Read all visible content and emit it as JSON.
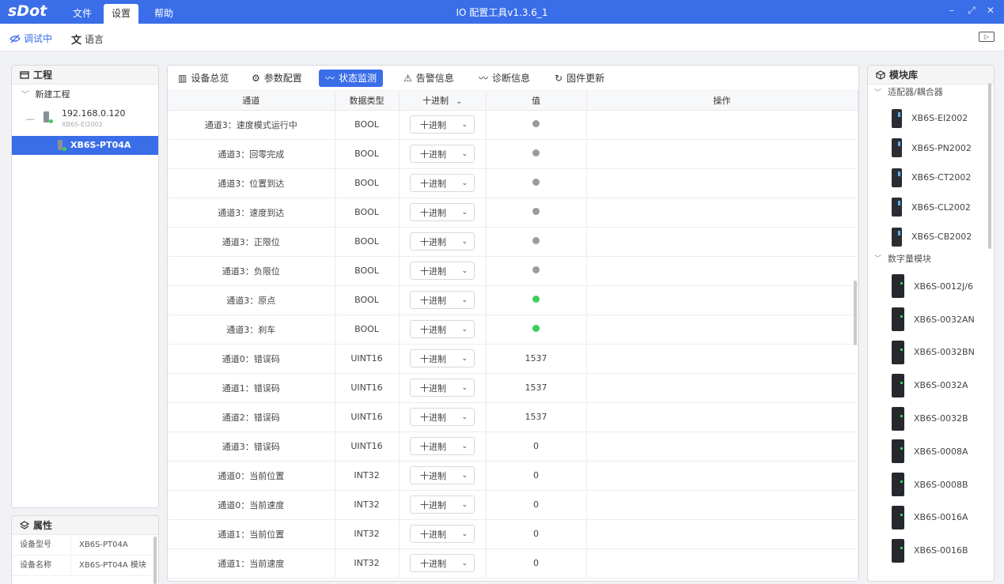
{
  "app": {
    "logo": "sDot",
    "title": "IO 配置工具v1.3.6_1",
    "menu": [
      "文件",
      "设置",
      "帮助"
    ]
  },
  "toolbar": {
    "debug_label": "调试中",
    "language_label": "语言"
  },
  "project": {
    "title": "工程",
    "root": "新建工程",
    "device_ip": "192.168.0.120",
    "device_model": "XB6S-EI2002",
    "module": "XB6S-PT04A"
  },
  "properties": {
    "title": "属性",
    "rows": [
      {
        "key": "设备型号",
        "value": "XB6S-PT04A"
      },
      {
        "key": "设备名称",
        "value": "XB6S-PT04A 模块"
      }
    ]
  },
  "tabs": [
    "设备总览",
    "参数配置",
    "状态监测",
    "告警信息",
    "诊断信息",
    "固件更新"
  ],
  "active_tab": 2,
  "table": {
    "headers": {
      "channel": "通道",
      "type": "数据类型",
      "format": "十进制",
      "value": "值",
      "action": "操作"
    },
    "format_value": "十进制",
    "rows": [
      {
        "channel": "通道3：速度模式运行中",
        "type": "BOOL",
        "value": "",
        "status": "off"
      },
      {
        "channel": "通道3：回零完成",
        "type": "BOOL",
        "value": "",
        "status": "off"
      },
      {
        "channel": "通道3：位置到达",
        "type": "BOOL",
        "value": "",
        "status": "off"
      },
      {
        "channel": "通道3：速度到达",
        "type": "BOOL",
        "value": "",
        "status": "off"
      },
      {
        "channel": "通道3：正限位",
        "type": "BOOL",
        "value": "",
        "status": "off"
      },
      {
        "channel": "通道3：负限位",
        "type": "BOOL",
        "value": "",
        "status": "off"
      },
      {
        "channel": "通道3：原点",
        "type": "BOOL",
        "value": "",
        "status": "on"
      },
      {
        "channel": "通道3：刹车",
        "type": "BOOL",
        "value": "",
        "status": "on"
      },
      {
        "channel": "通道0：错误码",
        "type": "UINT16",
        "value": "1537",
        "status": ""
      },
      {
        "channel": "通道1：错误码",
        "type": "UINT16",
        "value": "1537",
        "status": ""
      },
      {
        "channel": "通道2：错误码",
        "type": "UINT16",
        "value": "1537",
        "status": ""
      },
      {
        "channel": "通道3：错误码",
        "type": "UINT16",
        "value": "0",
        "status": ""
      },
      {
        "channel": "通道0：当前位置",
        "type": "INT32",
        "value": "0",
        "status": ""
      },
      {
        "channel": "通道0：当前速度",
        "type": "INT32",
        "value": "0",
        "status": ""
      },
      {
        "channel": "通道1：当前位置",
        "type": "INT32",
        "value": "0",
        "status": ""
      },
      {
        "channel": "通道1：当前速度",
        "type": "INT32",
        "value": "0",
        "status": ""
      }
    ]
  },
  "library": {
    "title": "模块库",
    "categories": [
      {
        "name": "适配器/耦合器",
        "items": [
          "XB6S-EI2002",
          "XB6S-PN2002",
          "XB6S-CT2002",
          "XB6S-CL2002",
          "XB6S-CB2002"
        ]
      },
      {
        "name": "数字量模块",
        "items": [
          "XB6S-0012J/6",
          "XB6S-0032AN",
          "XB6S-0032BN",
          "XB6S-0032A",
          "XB6S-0032B",
          "XB6S-0008A",
          "XB6S-0008B",
          "XB6S-0016A",
          "XB6S-0016B"
        ]
      }
    ]
  },
  "colors": {
    "accent": "#3a6ee8",
    "status_on": "#3bcf5a",
    "status_off": "#9b9b9b"
  }
}
